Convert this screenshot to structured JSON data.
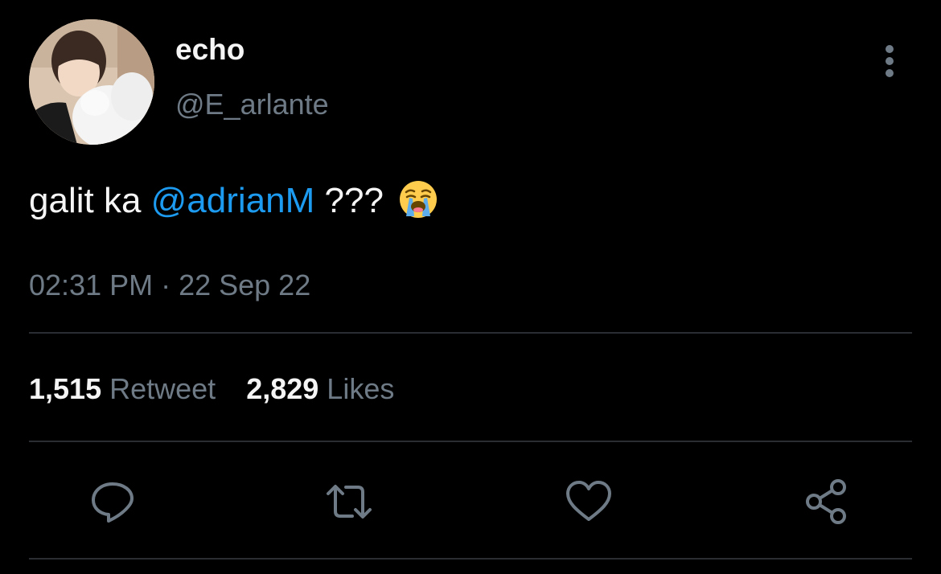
{
  "user": {
    "display_name": "echo",
    "handle": "@E_arlante"
  },
  "tweet": {
    "text_before": "galit ka ",
    "mention": "@adrianM",
    "text_after": " ??? ",
    "emoji": "loudly-crying-face-emoji",
    "timestamp": "02:31 PM · 22 Sep 22"
  },
  "stats": {
    "retweets_count": "1,515",
    "retweets_label": "Retweet",
    "likes_count": "2,829",
    "likes_label": "Likes"
  },
  "actions": [
    "reply-icon",
    "retweet-icon",
    "like-icon",
    "share-icon"
  ],
  "colors": {
    "background": "#000000",
    "text": "#f5f5f5",
    "secondary": "#6e7a85",
    "mention": "#1d9bf0",
    "divider": "#2a2d31"
  }
}
